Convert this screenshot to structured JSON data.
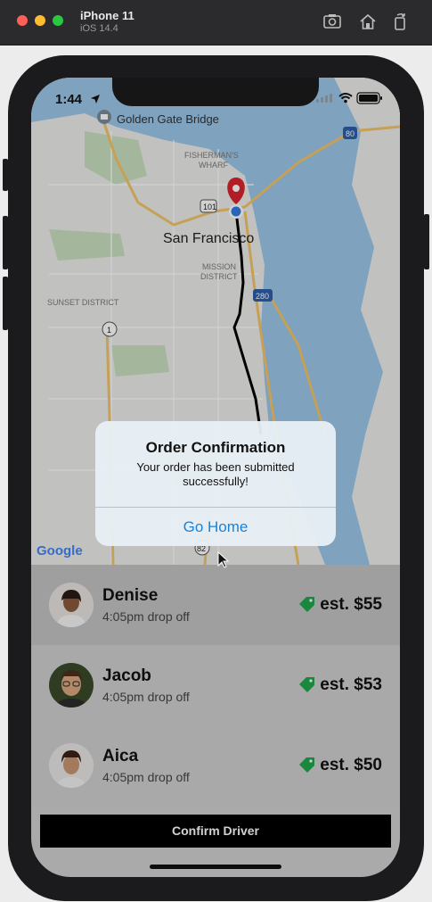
{
  "simulator": {
    "device_name": "iPhone 11",
    "os_version": "iOS 14.4"
  },
  "status_bar": {
    "time": "1:44"
  },
  "map": {
    "labels": {
      "golden_gate": "Golden Gate Bridge",
      "fishermans_wharf_1": "FISHERMAN'S",
      "fishermans_wharf_2": "WHARF",
      "city": "San Francisco",
      "mission_1": "MISSION",
      "mission_2": "DISTRICT",
      "sunset": "SUNSET DISTRICT",
      "hw_101": "101",
      "hw_80": "80",
      "hw_280": "280",
      "hw_1": "1",
      "hw_82": "82",
      "google": "Google"
    }
  },
  "alert": {
    "title": "Order Confirmation",
    "message": "Your order has been submitted successfully!",
    "button": "Go Home"
  },
  "drivers": [
    {
      "name": "Denise",
      "dropoff": "4:05pm drop off",
      "price": "est. $55"
    },
    {
      "name": "Jacob",
      "dropoff": "4:05pm drop off",
      "price": "est. $53"
    },
    {
      "name": "Aica",
      "dropoff": "4:05pm drop off",
      "price": "est. $50"
    }
  ],
  "confirm_button": "Confirm Driver",
  "colors": {
    "accent_green": "#1fa64a",
    "alert_blue": "#1a82d6",
    "pin_red": "#d9232e"
  }
}
